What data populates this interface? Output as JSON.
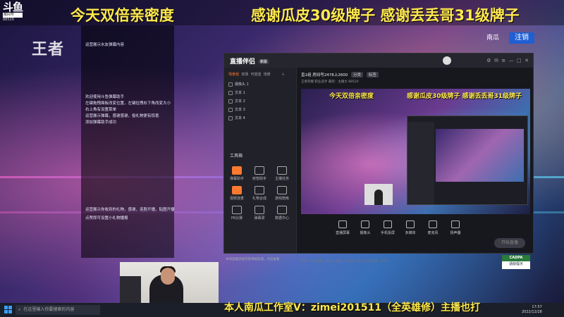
{
  "stream": {
    "title_left": "今天双倍亲密度",
    "title_right": "感谢瓜皮30级牌子 感谢丢丢哥31级牌子",
    "marquee": "本人南瓜工作室V：zimei201511（全英雄修）主播也打",
    "game_logo": "王者"
  },
  "douyu_logo": {
    "big": "斗鱼",
    "small": "房间号",
    "room": "88520"
  },
  "left_overlay": {
    "top_line": "运营展示水友弹幕内容",
    "lines": [
      "欢迎使用斗鱼弹幕助手",
      "左键拖拽面板改变位置，左键拉拽右下角改变大小",
      "右上角有设置菜单",
      "运营展示弹幕，感谢感谢，投礼物更有惊喜",
      "添加弹幕助手成功"
    ],
    "bottom_lines": [
      "运营展示你收到的礼物，感谢，连胜开播，贴图开播",
      "点赞即可设置小礼物播报"
    ]
  },
  "header_right": {
    "nangua_label": "南瓜",
    "logout_label": "注销"
  },
  "app": {
    "name": "直播伴侣",
    "badge": "新版",
    "tabs": [
      "场景组",
      "双场",
      "可放送",
      "场景"
    ],
    "active_tab": "场景组",
    "sources": [
      "摄像头 1",
      "文本 1",
      "文本 2",
      "文本 3",
      "文本 4"
    ],
    "toolbox_title": "工具箱",
    "tools": [
      {
        "label": "弹幕助手",
        "icon": "danmu-icon"
      },
      {
        "label": "房管助手",
        "icon": "admin-icon"
      },
      {
        "label": "主播任务",
        "icon": "task-icon"
      },
      {
        "label": "视频连麦",
        "icon": "video-icon"
      },
      {
        "label": "礼物合成",
        "icon": "gift-icon"
      },
      {
        "label": "游戏陪练",
        "icon": "game-icon"
      },
      {
        "label": "PK比赛",
        "icon": "pk-icon"
      },
      {
        "label": "弹幕录",
        "icon": "record-icon"
      },
      {
        "label": "数据中心",
        "icon": "chart-icon"
      }
    ],
    "notice": "本场直播违规内容将被处理，点击查看",
    "room_line": "直1组 房间号2478上2600",
    "room_tags": [
      "分类",
      "标签"
    ],
    "room_sub": "王者荣耀  职业选手  最新：主播大 88520",
    "preview_title_left": "今天双倍亲密度",
    "preview_title_right": "感谢瓜皮30级牌子 感谢丢丢哥31级牌子",
    "bottom_actions": [
      "直播屏幕",
      "摄像头",
      "手机投屏",
      "多媒体",
      "麦克风",
      "扬声器"
    ],
    "start_button": "开始直播",
    "stats": "帧率：60  码率：0kbps  丢帧：0.00%  CPU:23%  内存：47%"
  },
  "cadpa": {
    "line1": "CADPA",
    "line2": "适龄提示"
  },
  "taskbar": {
    "search_placeholder": "在这里输入你要搜索的内容",
    "time": "17:57",
    "date": "2022/12/28"
  }
}
